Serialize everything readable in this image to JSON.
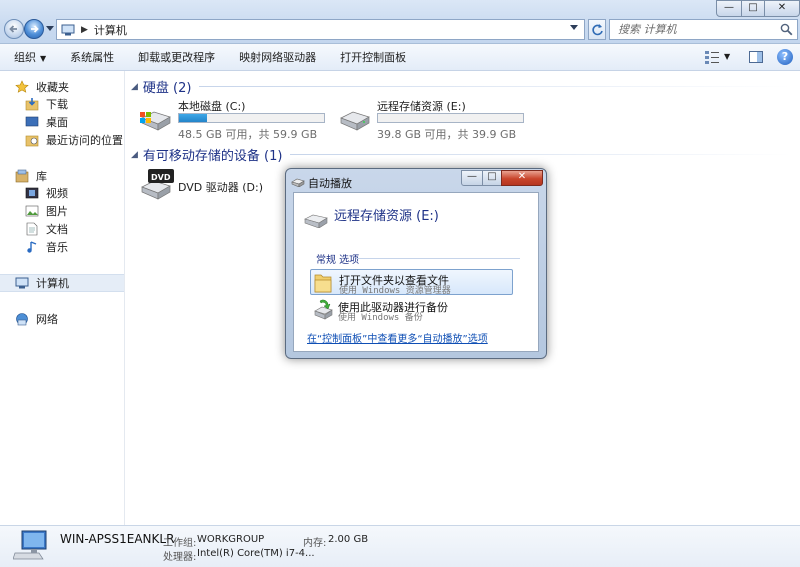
{
  "window": {
    "address_crumb": "计算机",
    "search_placeholder": "搜索 计算机",
    "controls": {
      "minimize": "—",
      "maximize": "□",
      "close": "✕"
    }
  },
  "toolbar": {
    "organize": "组织",
    "system_properties": "系统属性",
    "uninstall": "卸载或更改程序",
    "map_drive": "映射网络驱动器",
    "control_panel": "打开控制面板",
    "help": "?"
  },
  "sidebar": {
    "favorites": "收藏夹",
    "downloads": "下载",
    "desktop": "桌面",
    "recent": "最近访问的位置",
    "libraries": "库",
    "videos": "视频",
    "pictures": "图片",
    "documents": "文档",
    "music": "音乐",
    "computer": "计算机",
    "network": "网络"
  },
  "content": {
    "hard_disks_header": "硬盘 (2)",
    "removable_header": "有可移动存储的设备 (1)",
    "drives": [
      {
        "name": "本地磁盘 (C:)",
        "free_text": "48.5 GB 可用，共 59.9 GB",
        "used_fraction": 0.19
      },
      {
        "name": "远程存储资源 (E:)",
        "free_text": "39.8 GB 可用，共 39.9 GB",
        "used_fraction": 0.0
      }
    ],
    "dvd": {
      "name": "DVD 驱动器 (D:)",
      "badge": "DVD"
    }
  },
  "details": {
    "computer_name": "WIN-APSS1EANKLR",
    "workgroup_label": "工作组:",
    "workgroup_value": "WORKGROUP",
    "memory_label": "内存:",
    "memory_value": "2.00 GB",
    "processor_label": "处理器:",
    "processor_value": "Intel(R) Core(TM) i7-4..."
  },
  "autoplay": {
    "title": "自动播放",
    "drive_name": "远程存储资源 (E:)",
    "section": "常规 选项",
    "options": [
      {
        "title": "打开文件夹以查看文件",
        "sub": "使用 Windows 资源管理器"
      },
      {
        "title": "使用此驱动器进行备份",
        "sub": "使用 Windows 备份"
      }
    ],
    "link": "在“控制面板”中查看更多“自动播放”选项",
    "controls": {
      "minimize": "—",
      "maximize": "□",
      "close": "✕"
    }
  },
  "colors": {
    "accent": "#1e3287",
    "link": "#0f4fb5",
    "disk_fill": "#2a8fd3"
  }
}
